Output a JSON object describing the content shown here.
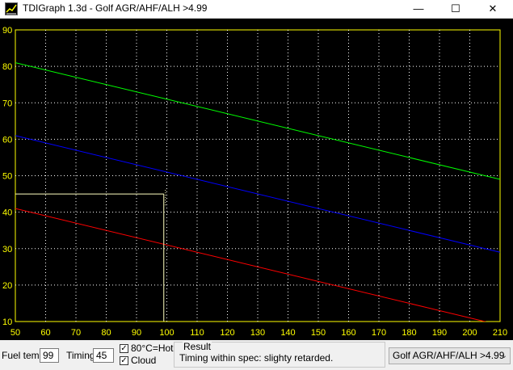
{
  "window": {
    "title": "TDIGraph 1.3d - Golf AGR/AHF/ALH >4.99",
    "minimize_glyph": "—",
    "maximize_glyph": "☐",
    "close_glyph": "✕"
  },
  "colors": {
    "background": "#000000",
    "grid": "#ffffff",
    "tick_labels": "#ffff00",
    "axis": "#ffff00",
    "upper_limit": "#00ff00",
    "nominal": "#0000ff",
    "lower_limit": "#ff0000",
    "marker": "#ffffc0"
  },
  "chart_data": {
    "type": "line",
    "title": "",
    "xlabel": "",
    "ylabel": "",
    "xlim": [
      50,
      210
    ],
    "ylim": [
      10,
      90
    ],
    "x_ticks": [
      50,
      60,
      70,
      80,
      90,
      100,
      110,
      120,
      130,
      140,
      150,
      160,
      170,
      180,
      190,
      200,
      210
    ],
    "y_ticks": [
      10,
      20,
      30,
      40,
      50,
      60,
      70,
      80,
      90
    ],
    "grid": true,
    "series": [
      {
        "color": "#00ff00",
        "x": [
          50,
          210
        ],
        "y": [
          81,
          49
        ]
      },
      {
        "color": "#0000ff",
        "x": [
          50,
          210
        ],
        "y": [
          61,
          29
        ]
      },
      {
        "color": "#ff0000",
        "x": [
          50,
          210
        ],
        "y": [
          41,
          9
        ]
      }
    ],
    "marker": {
      "x": 99,
      "y": 45
    }
  },
  "controls": {
    "fuel_temp_label": "Fuel temp",
    "fuel_temp_value": "99",
    "timing_label": "Timing",
    "timing_value": "45",
    "hot_checkbox_label": "80°C=Hot",
    "hot_checked": true,
    "cloud_checkbox_label": "Cloud",
    "cloud_checked": true,
    "check_glyph": "✓",
    "result_label": "Result",
    "result_text": "Timing within spec: slighty retarded.",
    "model_select_value": "Golf AGR/AHF/ALH >4.99",
    "select_arrow_glyph": "⌄"
  }
}
